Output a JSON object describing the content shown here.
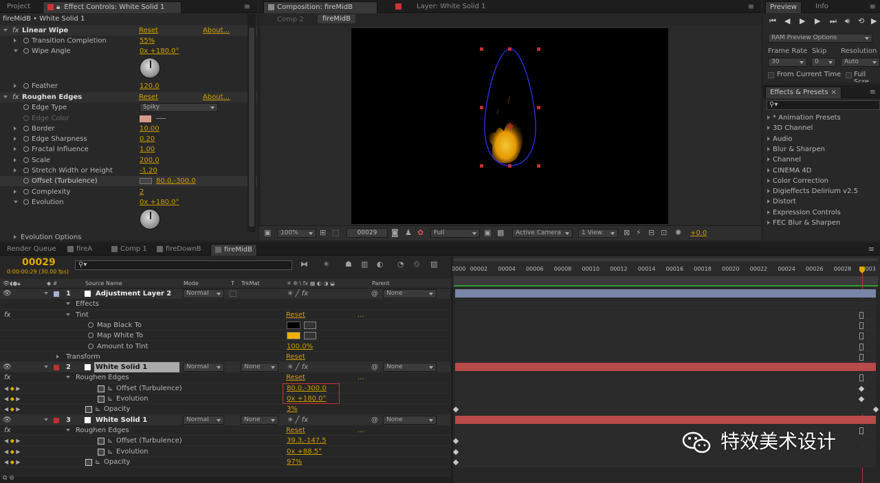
{
  "effect_controls": {
    "tabs": {
      "project": "Project",
      "effect_controls": "Effect Controls: White Solid 1"
    },
    "layer_path": "fireMidB • White Solid 1",
    "linear_wipe": {
      "name": "Linear Wipe",
      "reset": "Reset",
      "about": "About...",
      "transition_completion_label": "Transition Completion",
      "transition_completion": "55%",
      "wipe_angle_label": "Wipe Angle",
      "wipe_angle": "0x +180.0°",
      "feather_label": "Feather",
      "feather": "120.0"
    },
    "roughen_edges": {
      "name": "Roughen Edges",
      "reset": "Reset",
      "about": "About...",
      "edge_type_label": "Edge Type",
      "edge_type": "Spiky",
      "edge_color_label": "Edge Color",
      "border_label": "Border",
      "border": "10.00",
      "edge_sharpness_label": "Edge Sharpness",
      "edge_sharpness": "0.20",
      "fractal_influence_label": "Fractal Influence",
      "fractal_influence": "1.00",
      "scale_label": "Scale",
      "scale": "200.0",
      "stretch_label": "Stretch Width or Height",
      "stretch": "-1.20",
      "offset_label": "Offset (Turbulence)",
      "offset": "80.0,-300.0",
      "complexity_label": "Complexity",
      "complexity": "2",
      "evolution_label": "Evolution",
      "evolution": "0x +180.0°",
      "evolution_options_label": "Evolution Options"
    }
  },
  "composition": {
    "tabs": {
      "composition": "Composition: fireMidB",
      "layer": "Layer: White Solid 1"
    },
    "breadcrumbs": [
      "Comp 2",
      "fireMidB"
    ],
    "footer": {
      "zoom": "100%",
      "timecode": "00029",
      "resolution": "Full",
      "camera": "Active Camera",
      "view": "1 View",
      "exposure": "+0.0"
    }
  },
  "preview": {
    "tabs": {
      "preview": "Preview",
      "info": "Info"
    },
    "ram_preview": "RAM Preview Options",
    "frame_rate_label": "Frame Rate",
    "skip_label": "Skip",
    "resolution_label": "Resolution",
    "frame_rate": "30",
    "skip": "0",
    "resolution": "Auto",
    "from_current_time": "From Current Time",
    "full_screen": "Full Scre"
  },
  "effects_presets": {
    "tab": "Effects & Presets",
    "search": "",
    "items": [
      "* Animation Presets",
      "3D Channel",
      "Audio",
      "Blur & Sharpen",
      "Channel",
      "CINEMA 4D",
      "Color Correction",
      "Digieffects Delirium v2.5",
      "Distort",
      "Expression Controls",
      "FEC Blur & Sharpen"
    ]
  },
  "timeline": {
    "tabs": [
      "Render Queue",
      "fireA",
      "Comp 1",
      "fireDownB",
      "fireMidB"
    ],
    "timecode": "00029",
    "timecode_sub": "0:00:00:29 (30.00 fps)",
    "columns": {
      "source_name": "Source Name",
      "mode": "Mode",
      "t": "T",
      "trkmat": "TrkMat",
      "parent": "Parent"
    },
    "ruler": [
      "0000",
      "00002",
      "00004",
      "00006",
      "00008",
      "00010",
      "00012",
      "00014",
      "00016",
      "00018",
      "00020",
      "00022",
      "00024",
      "00026",
      "00028",
      "0003"
    ],
    "layers": {
      "l1": {
        "num": "1",
        "name": "Adjustment Layer 2",
        "mode": "Normal",
        "parent": "None"
      },
      "effects_label": "Effects",
      "tint_label": "Tint",
      "tint_reset": "Reset",
      "map_black_label": "Map Black To",
      "map_white_label": "Map White To",
      "amount_label": "Amount to Tint",
      "amount": "100.0%",
      "transform_label": "Transform",
      "transform_reset": "Reset",
      "l2": {
        "num": "2",
        "name": "White Solid 1",
        "mode": "Normal",
        "trkmat": "None",
        "parent": "None"
      },
      "l2_roughen_label": "Roughen Edges",
      "l2_roughen_reset": "Reset",
      "l2_offset_label": "Offset (Turbulence)",
      "l2_offset": "80.0,-300.0",
      "l2_evolution_label": "Evolution",
      "l2_evolution": "0x +180.0°",
      "l2_opacity_label": "Opacity",
      "l2_opacity": "3%",
      "l3": {
        "num": "3",
        "name": "White Solid 1",
        "mode": "Normal",
        "trkmat": "None",
        "parent": "None"
      },
      "l3_roughen_label": "Roughen Edges",
      "l3_roughen_reset": "Reset",
      "l3_offset_label": "Offset (Turbulence)",
      "l3_offset": "39.3,-147.5",
      "l3_evolution_label": "Evolution",
      "l3_evolution": "0x +88.5°",
      "l3_opacity_label": "Opacity",
      "l3_opacity": "97%"
    }
  },
  "watermark": "特效美术设计",
  "colors": {
    "accent": "#d0a000",
    "layer_red": "#b84a4a",
    "layer_blue": "#7a86a8",
    "tint_white": "#f0b000"
  }
}
